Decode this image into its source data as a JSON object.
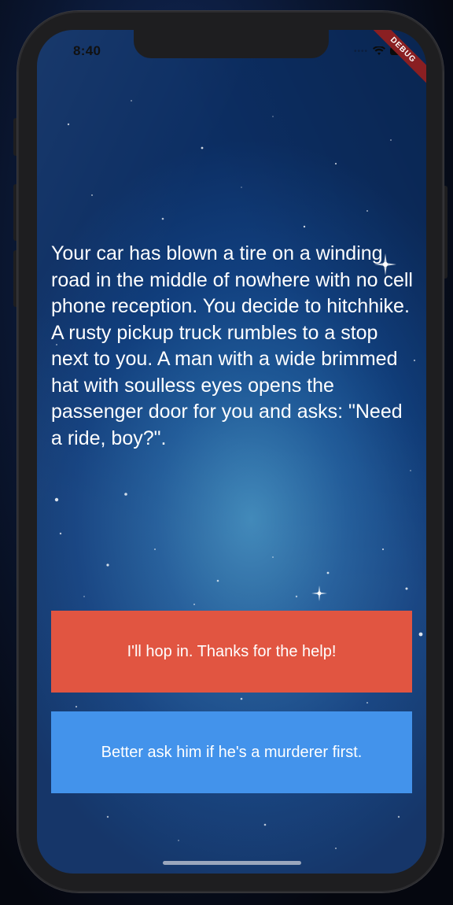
{
  "status_bar": {
    "time": "8:40"
  },
  "debug_banner": {
    "label": "DEBUG"
  },
  "story": {
    "text": "Your car has blown a tire on a winding road in the middle of nowhere with no cell phone reception. You decide to hitchhike. A rusty pickup truck rumbles to a stop next to you. A man with a wide brimmed hat with soulless eyes opens the passenger door for you and asks: \"Need a ride, boy?\"."
  },
  "choices": [
    {
      "label": "I'll hop in. Thanks for the help!",
      "color": "#E15541"
    },
    {
      "label": "Better ask him if he's a murderer first.",
      "color": "#4393EB"
    }
  ],
  "theme": {
    "background": "starry-night-blue",
    "text_color": "#FFFFFF"
  }
}
